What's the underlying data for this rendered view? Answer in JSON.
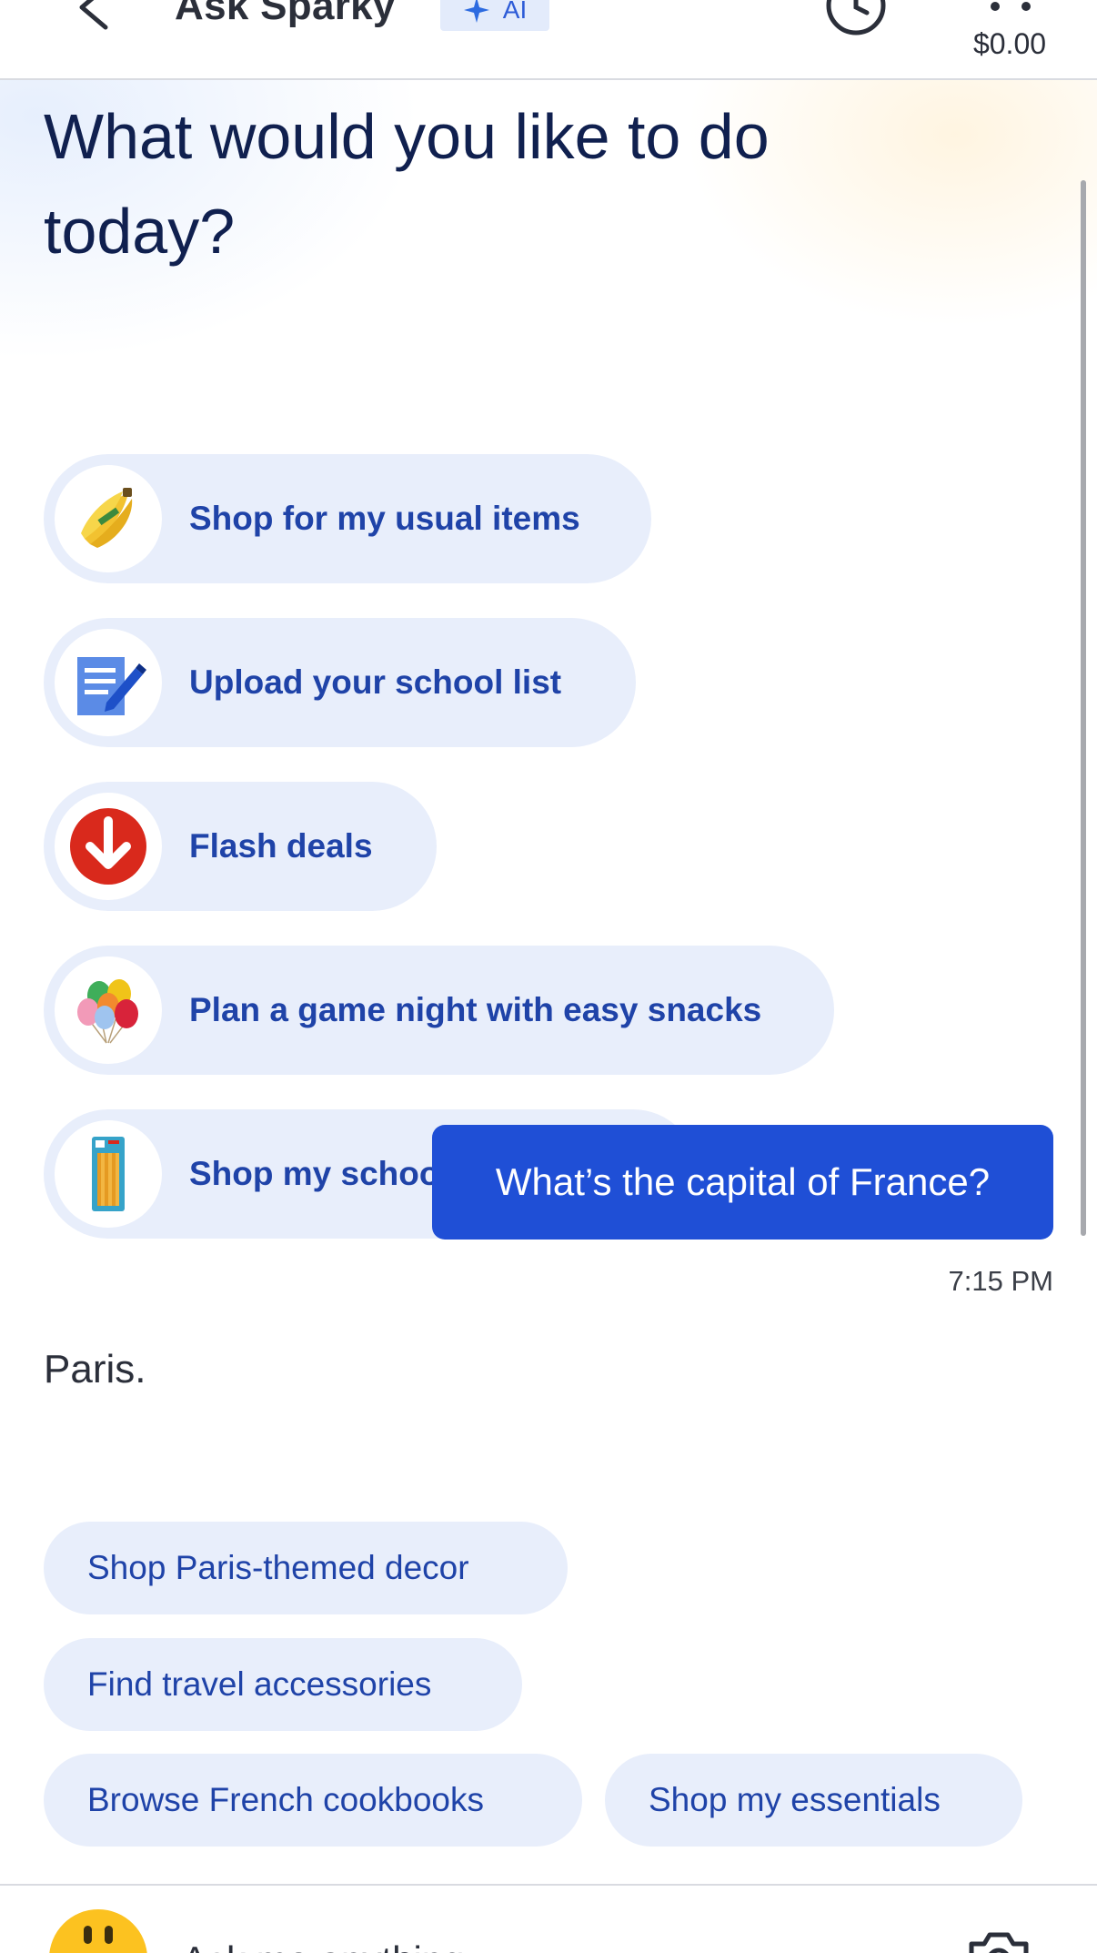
{
  "header": {
    "title": "Ask Sparky",
    "ai_badge": "AI",
    "cart_total": "$0.00",
    "icons": [
      "back-icon",
      "sparkle-icon",
      "history-icon",
      "cart-icon"
    ]
  },
  "greeting": "What would you like to do today?",
  "suggestions": [
    {
      "label": "Shop for my usual items",
      "icon": "bananas-icon"
    },
    {
      "label": "Upload your school list",
      "icon": "notepad-pencil-icon"
    },
    {
      "label": "Flash deals",
      "icon": "down-arrow-badge-icon"
    },
    {
      "label": "Plan a game night with easy snacks",
      "icon": "balloons-icon"
    },
    {
      "label": "Shop my school supply list",
      "icon": "pencil-pack-icon"
    }
  ],
  "chat": {
    "user_message": "What’s the capital of France?",
    "timestamp": "7:15 PM",
    "answer": "Paris."
  },
  "followups": [
    "Shop Paris-themed decor",
    "Find travel accessories",
    "Browse French cookbooks",
    "Shop my essentials"
  ],
  "composer": {
    "placeholder": "Ask me anything",
    "icons": [
      "avatar-icon",
      "camera-icon"
    ]
  },
  "colors": {
    "accent": "#1f4fd6",
    "chip_bg": "#e8eefb",
    "chip_text": "#1f43a8",
    "heading": "#10204f",
    "avatar": "#fcc220",
    "deals_red": "#d9291c"
  }
}
